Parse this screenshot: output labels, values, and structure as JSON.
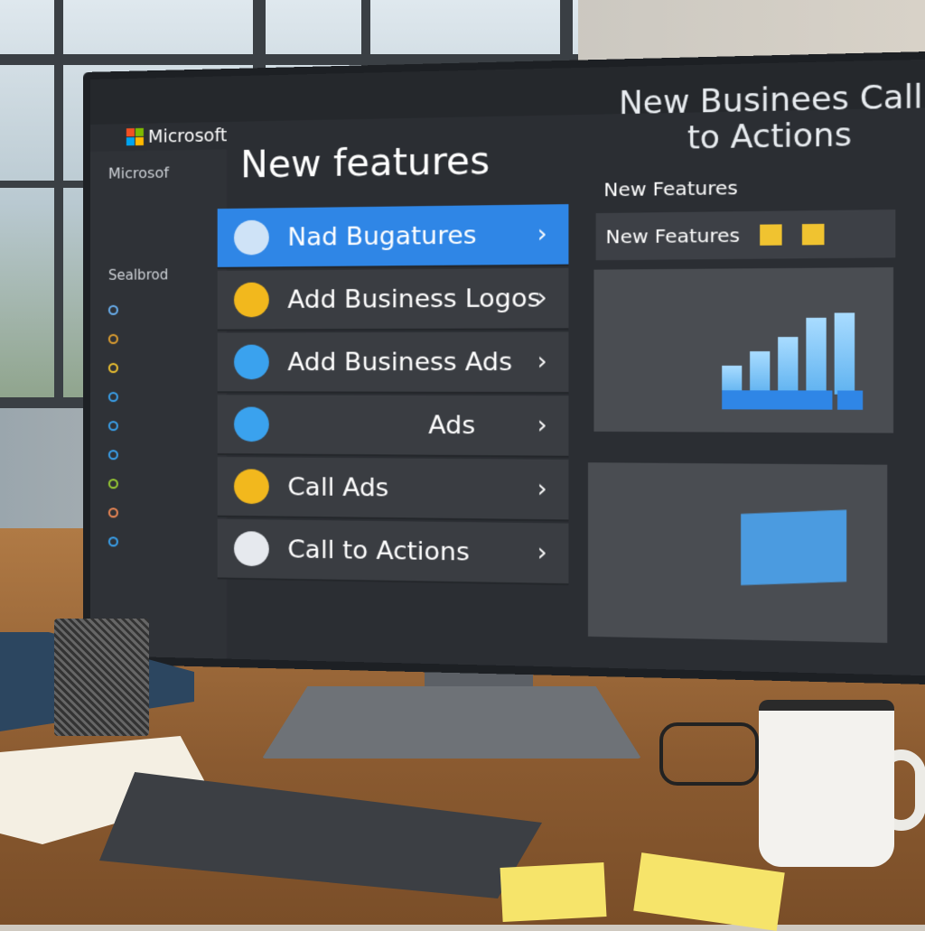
{
  "scene": {
    "desk_color": "#9a6a3a",
    "screen_bg": "#2b2e33",
    "accent": "#2f86e6"
  },
  "app": {
    "brand": "Microsoft",
    "sidebar": {
      "items": [
        {
          "label": "Microsof"
        },
        {
          "label": "Sealbrod"
        }
      ]
    },
    "main": {
      "title": "New features",
      "rows": [
        {
          "label": "Nad Bugatures",
          "selected": true,
          "icon": "user-icon",
          "icon_color": "#cfe3f7"
        },
        {
          "label": "Add Business Logos",
          "icon": "chat-icon",
          "icon_color": "#f2b81d"
        },
        {
          "label": "Add Business Ads",
          "icon": "person-icon",
          "icon_color": "#3aa2ee"
        },
        {
          "label": "Ads",
          "icon": "cloud-icon",
          "icon_color": "#3aa2ee"
        },
        {
          "label": "Call Ads",
          "icon": "lock-icon",
          "icon_color": "#f2b81d"
        },
        {
          "label": "Call to Actions",
          "icon": "send-icon",
          "icon_color": "#e6e9ee"
        }
      ]
    },
    "right_panel": {
      "title": "New Businees Call to Actions",
      "subtitle": "New Features",
      "box_label": "New Features",
      "bar_chart_levels": [
        0.3,
        0.45,
        0.6,
        0.8,
        0.85
      ],
      "chart_color": "#5fb2f0"
    }
  }
}
